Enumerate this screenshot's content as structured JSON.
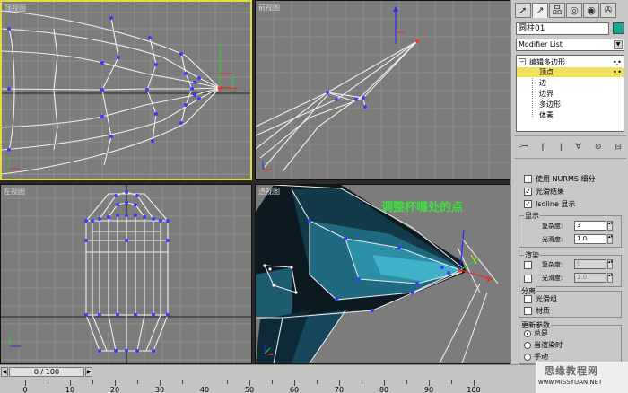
{
  "viewports": {
    "top_label": "顶视图",
    "front_label": "前视图",
    "left_label": "左视图",
    "persp_label": "透视图",
    "annotation": "调整杯嘴处的点"
  },
  "panel": {
    "tab_icons": [
      "pointer-icon",
      "curve-icon",
      "hierarchy-icon",
      "motion-icon",
      "display-icon",
      "utility-icon"
    ],
    "object_name": "圆柱01",
    "object_color": "#1aa890",
    "modifier_list": "Modifier List",
    "stack": [
      {
        "label": "编辑多边形",
        "root": true
      },
      {
        "label": "顶点",
        "selected": true
      },
      {
        "label": "边"
      },
      {
        "label": "边界"
      },
      {
        "label": "多边形"
      },
      {
        "label": "体素"
      }
    ],
    "stack_tools": [
      "-ꟷ",
      "ǀI",
      "ǀ",
      "∀",
      "⊙",
      "⊟"
    ],
    "nurms": {
      "use_nurms_label": "使用 NURMS 细分",
      "use_nurms_checked": false,
      "smooth_result_label": "光滑结果",
      "smooth_result_checked": true,
      "isoline_label": "Isoline 显示",
      "isoline_checked": true,
      "display_group": "显示",
      "iterations_label": "复杂度:",
      "iterations_value": "3",
      "smoothness_label": "光滑度:",
      "smoothness_value": "1.0",
      "render_group": "渲染",
      "render_iterations_label": "复杂度:",
      "render_iterations_value": "0",
      "render_smoothness_label": "光滑度:",
      "render_smoothness_value": "1.0",
      "separate_group": "分离",
      "smoothing_groups_label": "光滑组",
      "materials_label": "材质",
      "update_group": "更新参数",
      "always_label": "总是",
      "when_rendering_label": "当渲染时",
      "manually_label": "手动"
    }
  },
  "timeline": {
    "frame_display": "0 / 100",
    "ruler_labels": [
      "0",
      "10",
      "20",
      "30",
      "40",
      "50",
      "60",
      "70",
      "80",
      "90",
      "100"
    ]
  },
  "watermark": {
    "line1": "思缘教程网",
    "line2": "www.MISSYUAN.NET"
  }
}
